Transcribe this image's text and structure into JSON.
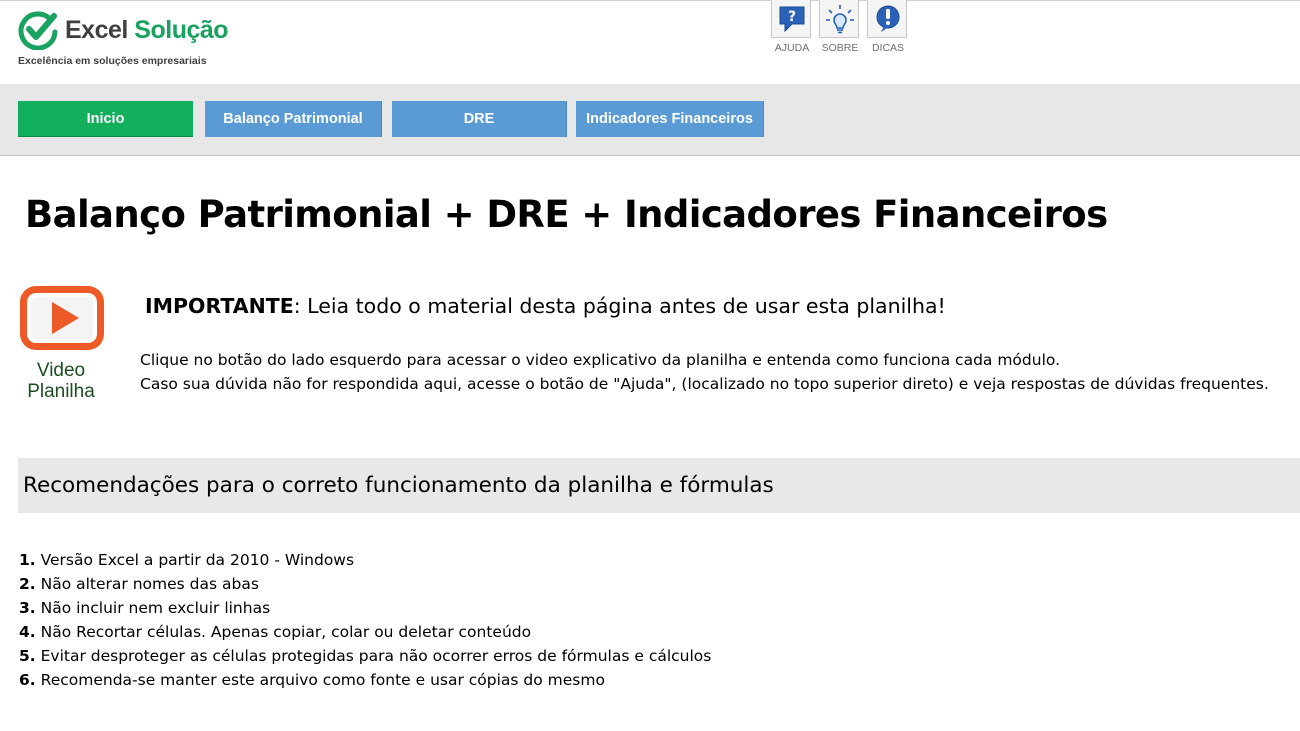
{
  "brand": {
    "name_part1": "Excel",
    "name_part2": "Solução",
    "tagline": "Excelência em soluções empresariais",
    "green": "#1aa260",
    "gray": "#404040"
  },
  "top_icons": [
    {
      "label": "AJUDA",
      "icon": "help-chat-icon"
    },
    {
      "label": "SOBRE",
      "icon": "lightbulb-icon"
    },
    {
      "label": "DICAS",
      "icon": "exclamation-icon"
    }
  ],
  "nav": {
    "items": [
      {
        "label": "Inicio",
        "active": true
      },
      {
        "label": "Balanço Patrimonial",
        "active": false
      },
      {
        "label": "DRE",
        "active": false
      },
      {
        "label": "Indicadores Financeiros",
        "active": false
      }
    ],
    "active_color": "#12b05c",
    "inactive_color": "#5b9bd5"
  },
  "page_title": "Balanço Patrimonial + DRE + Indicadores Financeiros",
  "video": {
    "label_line1": "Video",
    "label_line2": "Planilha",
    "icon": "play-button-icon",
    "color": "#ee5a25"
  },
  "important": {
    "label": "IMPORTANTE",
    "text": ": Leia todo o material desta página antes de usar esta planilha!"
  },
  "info_lines": [
    "Clique no botão do lado esquerdo para acessar o video explicativo da planilha e entenda como funciona cada módulo.",
    "Caso sua dúvida não for respondida aqui, acesse o botão de \"Ajuda\", (localizado no topo superior direto) e veja respostas de dúvidas frequentes."
  ],
  "recommendations": {
    "heading": "Recomendações para o correto funcionamento da planilha e fórmulas",
    "items": [
      {
        "num": "1.",
        "text": " Versão Excel a partir da 2010 - Windows"
      },
      {
        "num": "2.",
        "text": " Não alterar nomes das abas"
      },
      {
        "num": "3.",
        "text": " Não incluir nem excluir linhas"
      },
      {
        "num": "4.",
        "text": " Não Recortar células. Apenas copiar, colar ou deletar conteúdo"
      },
      {
        "num": "5.",
        "text": " Evitar desproteger as células protegidas para não ocorrer erros de fórmulas e cálculos"
      },
      {
        "num": "6.",
        "text": " Recomenda-se manter este arquivo como fonte e usar cópias do mesmo"
      }
    ]
  }
}
